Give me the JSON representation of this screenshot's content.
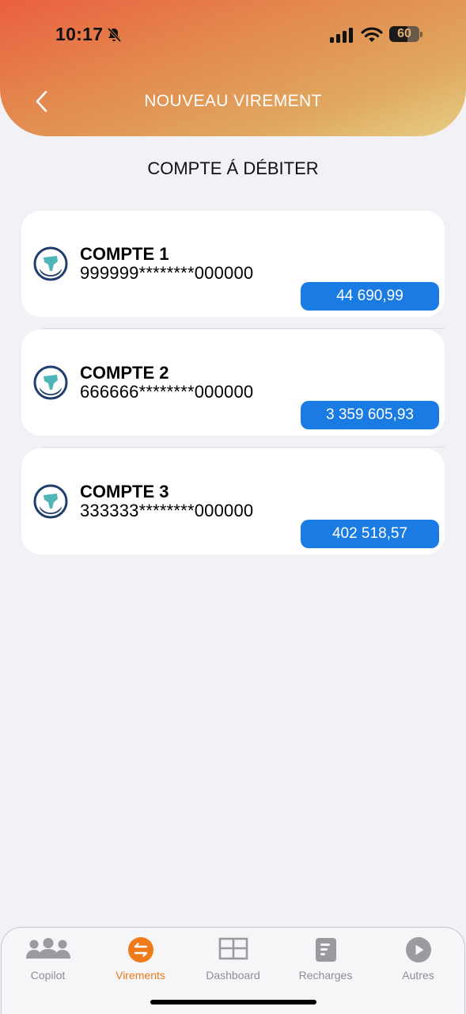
{
  "status_bar": {
    "time": "10:17",
    "battery": "60"
  },
  "header": {
    "title": "NOUVEAU VIREMENT"
  },
  "section_title": "COMPTE Á DÉBITER",
  "accounts": [
    {
      "name": "COMPTE 1",
      "number": "999999********000000",
      "balance": "44 690,99"
    },
    {
      "name": "COMPTE 2",
      "number": "666666********000000",
      "balance": "3 359 605,93"
    },
    {
      "name": "COMPTE 3",
      "number": "333333********000000",
      "balance": "402 518,57"
    }
  ],
  "tabs": [
    {
      "label": "Copilot",
      "icon": "people-icon"
    },
    {
      "label": "Virements",
      "icon": "transfer-icon",
      "active": true
    },
    {
      "label": "Dashboard",
      "icon": "dashboard-icon"
    },
    {
      "label": "Recharges",
      "icon": "recharge-icon"
    },
    {
      "label": "Autres",
      "icon": "play-icon"
    }
  ],
  "colors": {
    "accent": "#ef7a1a",
    "balance_badge": "#1a7be3",
    "header_start": "#ea5f3f",
    "header_end": "#e6cf85"
  }
}
